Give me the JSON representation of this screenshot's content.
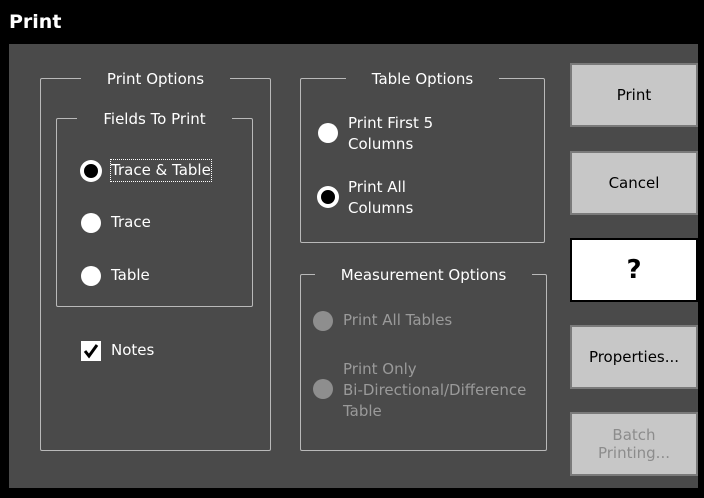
{
  "window": {
    "title": "Print"
  },
  "print_options": {
    "legend": "Print Options",
    "fields_legend": "Fields To Print",
    "fields": [
      {
        "label": "Trace & Table",
        "selected": true
      },
      {
        "label": "Trace",
        "selected": false
      },
      {
        "label": "Table",
        "selected": false
      }
    ],
    "notes": {
      "label": "Notes",
      "checked": true
    }
  },
  "table_options": {
    "legend": "Table Options",
    "items": [
      {
        "line1": "Print First 5",
        "line2": "Columns",
        "selected": false
      },
      {
        "line1": "Print All",
        "line2": "Columns",
        "selected": true
      }
    ]
  },
  "measurement_options": {
    "legend": "Measurement Options",
    "items": [
      {
        "line1": "Print All Tables",
        "enabled": false
      },
      {
        "line1": "Print Only",
        "line2": "Bi-Directional/Difference",
        "line3": "Table",
        "enabled": false
      }
    ]
  },
  "buttons": {
    "print": "Print",
    "cancel": "Cancel",
    "help": "?",
    "properties": "Properties...",
    "batch_line1": "Batch",
    "batch_line2": "Printing..."
  },
  "colors": {
    "background": "#4a4a4a",
    "button": "#c7c7c7",
    "titlebar": "#000000"
  }
}
